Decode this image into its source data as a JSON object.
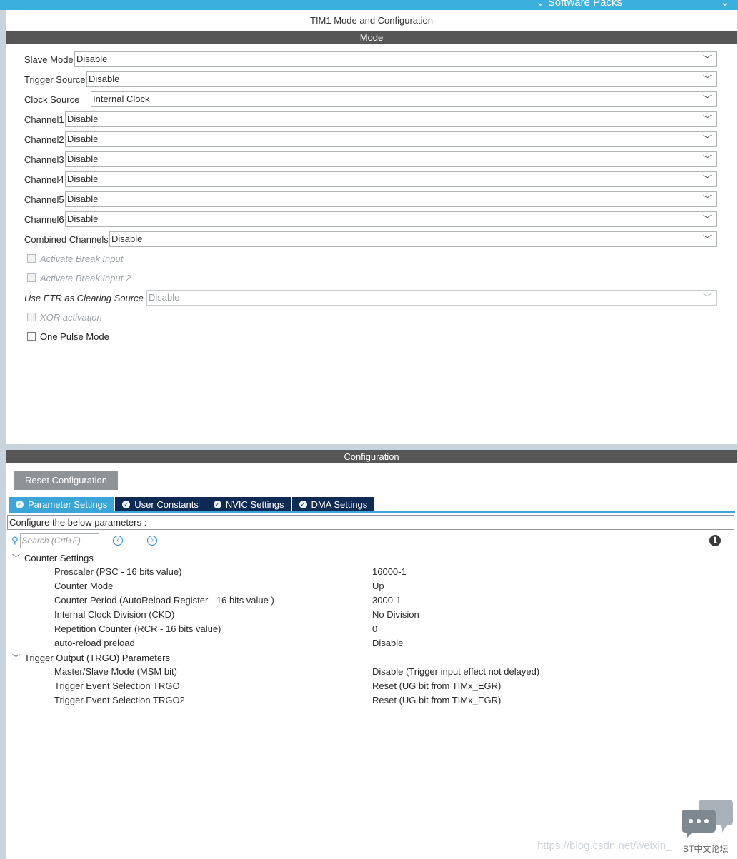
{
  "topbar": {
    "software_packs": "Software Packs",
    "chevron": "⌄"
  },
  "panel_title": "TIM1 Mode and Configuration",
  "mode": {
    "header": "Mode",
    "selects": [
      {
        "label": "Slave Mode",
        "value": "Disable"
      },
      {
        "label": "Trigger Source",
        "value": "Disable"
      },
      {
        "label": "Clock Source",
        "value": "Internal Clock"
      },
      {
        "label": "Channel1",
        "value": "Disable"
      },
      {
        "label": "Channel2",
        "value": "Disable"
      },
      {
        "label": "Channel3",
        "value": "Disable"
      },
      {
        "label": "Channel4",
        "value": "Disable"
      },
      {
        "label": "Channel5",
        "value": "Disable"
      },
      {
        "label": "Channel6",
        "value": "Disable"
      },
      {
        "label": "Combined Channels",
        "value": "Disable"
      }
    ],
    "activate_break_input": "Activate Break Input",
    "activate_break_input_2": "Activate Break Input 2",
    "etr": {
      "label": "Use ETR as Clearing Source",
      "value": "Disable"
    },
    "xor_activation": "XOR activation",
    "one_pulse_mode": "One Pulse Mode"
  },
  "configuration": {
    "header": "Configuration",
    "reset_button": "Reset Configuration",
    "tabs": [
      {
        "label": "Parameter Settings",
        "active": true
      },
      {
        "label": "User Constants",
        "active": false
      },
      {
        "label": "NVIC Settings",
        "active": false
      },
      {
        "label": "DMA Settings",
        "active": false
      }
    ],
    "configure_text": "Configure the below parameters :",
    "search_placeholder": "Search (Crtl+F)",
    "groups": [
      {
        "name": "Counter Settings",
        "params": [
          {
            "name": "Prescaler (PSC - 16 bits value)",
            "value": "16000-1"
          },
          {
            "name": "Counter Mode",
            "value": "Up"
          },
          {
            "name": "Counter Period (AutoReload Register - 16 bits value )",
            "value": "3000-1"
          },
          {
            "name": "Internal Clock Division (CKD)",
            "value": "No Division"
          },
          {
            "name": "Repetition Counter (RCR - 16 bits value)",
            "value": "0"
          },
          {
            "name": "auto-reload preload",
            "value": "Disable"
          }
        ]
      },
      {
        "name": "Trigger Output (TRGO) Parameters",
        "params": [
          {
            "name": "Master/Slave Mode (MSM bit)",
            "value": "Disable (Trigger input effect not delayed)"
          },
          {
            "name": "Trigger Event Selection TRGO",
            "value": "Reset (UG bit from TIMx_EGR)"
          },
          {
            "name": "Trigger Event Selection TRGO2",
            "value": "Reset (UG bit from TIMx_EGR)"
          }
        ]
      }
    ]
  },
  "watermark": "https://blog.csdn.net/weixin_",
  "forum_label": "ST中文论坛"
}
